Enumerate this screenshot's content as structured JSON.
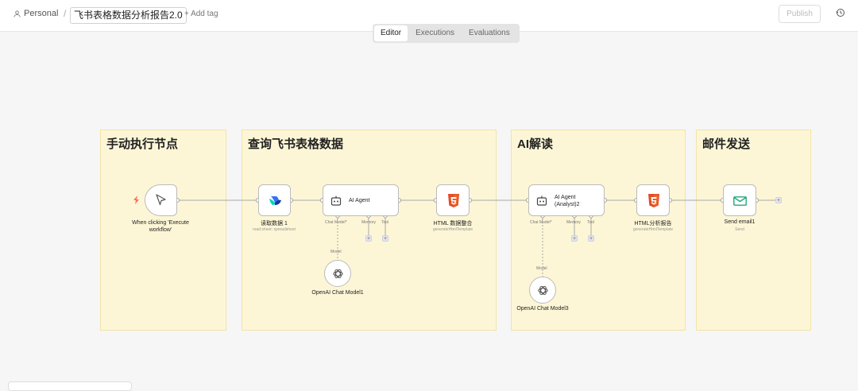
{
  "header": {
    "project": "Personal",
    "separator": "/",
    "workflow_name": "飞书表格数据分析报告2.0",
    "add_tag": "+ Add tag",
    "publish": "Publish"
  },
  "tabs": [
    "Editor",
    "Executions",
    "Evaluations"
  ],
  "stickies": [
    {
      "title": "手动执行节点"
    },
    {
      "title": "查询飞书表格数据"
    },
    {
      "title": "AI解读"
    },
    {
      "title": "邮件发送"
    }
  ],
  "nodes": {
    "trigger": {
      "title1": "When clicking 'Execute",
      "title2": "workflow'"
    },
    "read": {
      "title": "读取数据 1",
      "sub": "read:sheet: spreadsheet"
    },
    "agent1": {
      "title": "AI Agent",
      "chat_model": "Chat Model*",
      "memory": "Memory",
      "tool": "Tool"
    },
    "html1": {
      "title": "HTML 数据整合",
      "sub": "generateHtmlTemplate"
    },
    "openai1": {
      "title": "OpenAI Chat Model1",
      "model_label": "Model"
    },
    "agent2": {
      "title1": "AI Agent",
      "title2": "(Analyst)2",
      "chat_model": "Chat Model*",
      "memory": "Memory",
      "tool": "Tool"
    },
    "html2": {
      "title": "HTML分析报告",
      "sub": "generateHtmlTemplate"
    },
    "openai3": {
      "title": "OpenAI Chat Model3",
      "model_label": "Model"
    },
    "email": {
      "title": "Send email1",
      "sub": "Send"
    }
  },
  "colors": {
    "sticky_bg": "#fdf6d6",
    "html5_orange": "#e44d26",
    "email_green": "#22a87a",
    "trigger_red": "#ff6d5a",
    "feishu_blue": "#3370ff"
  }
}
